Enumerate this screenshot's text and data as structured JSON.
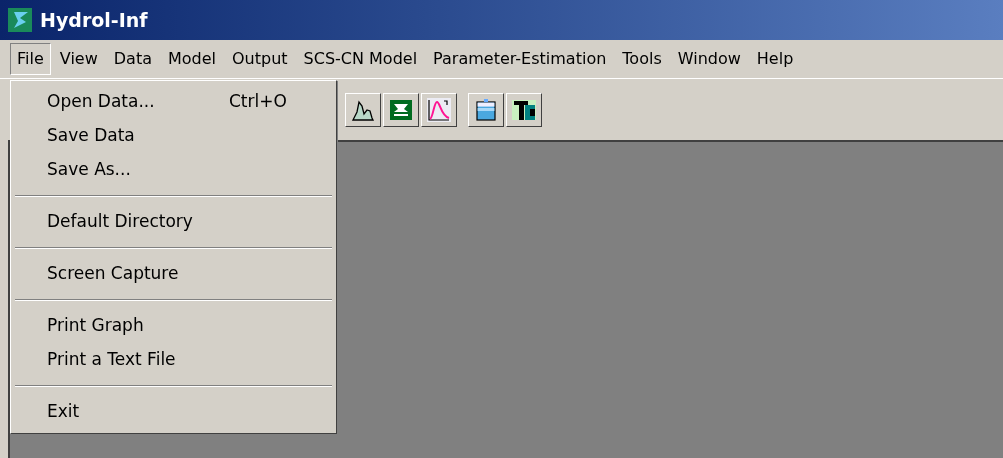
{
  "window": {
    "title": "Hydrol-Inf"
  },
  "menu_bar": [
    {
      "label": "File",
      "selected": true
    },
    {
      "label": "View",
      "selected": false
    },
    {
      "label": "Data",
      "selected": false
    },
    {
      "label": "Model",
      "selected": false
    },
    {
      "label": "Output",
      "selected": false
    },
    {
      "label": "SCS-CN Model",
      "selected": false
    },
    {
      "label": "Parameter-Estimation",
      "selected": false
    },
    {
      "label": "Tools",
      "selected": false
    },
    {
      "label": "Window",
      "selected": false
    },
    {
      "label": "Help",
      "selected": false
    }
  ],
  "file_menu": [
    {
      "kind": "item",
      "label": "Open Data...",
      "shortcut": "Ctrl+O"
    },
    {
      "kind": "item",
      "label": "Save Data"
    },
    {
      "kind": "item",
      "label": "Save As..."
    },
    {
      "kind": "separator"
    },
    {
      "kind": "item",
      "label": "Default Directory"
    },
    {
      "kind": "separator"
    },
    {
      "kind": "item",
      "label": "Screen Capture"
    },
    {
      "kind": "separator"
    },
    {
      "kind": "item",
      "label": "Print Graph"
    },
    {
      "kind": "item",
      "label": "Print a Text File"
    },
    {
      "kind": "separator"
    },
    {
      "kind": "item",
      "label": "Exit"
    }
  ],
  "toolbar_groups": [
    [
      {
        "kind": "hydrograph"
      },
      {
        "kind": "spreadsheet"
      },
      {
        "kind": "curve"
      }
    ],
    [
      {
        "kind": "tank"
      },
      {
        "kind": "tc"
      }
    ]
  ]
}
